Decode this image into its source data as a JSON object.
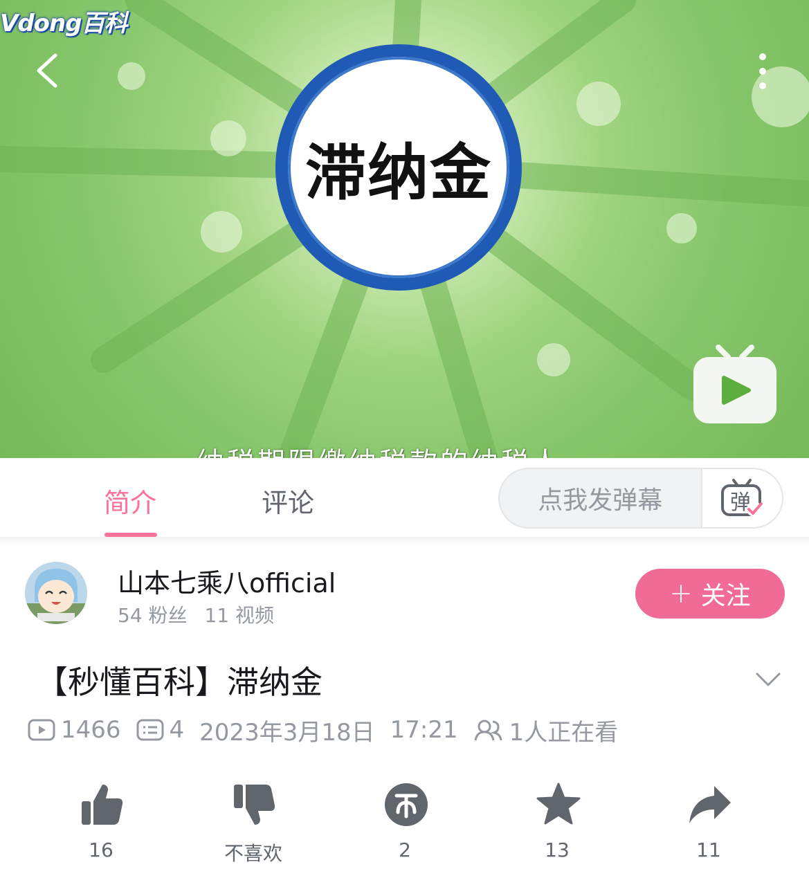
{
  "player": {
    "watermark": "Vdong百科",
    "cover_text": "滞纳金",
    "subtitle": "纳税期限缴纳税款的纳税人"
  },
  "tabs": [
    {
      "label": "简介",
      "active": true
    },
    {
      "label": "评论",
      "active": false
    }
  ],
  "danmaku": {
    "placeholder": "点我发弹幕",
    "toggle_glyph": "弹"
  },
  "uploader": {
    "name": "山本七乘八official",
    "fans": "54 粉丝",
    "videos": "11 视频",
    "follow_label": "关注",
    "follow_plus": "+"
  },
  "video": {
    "title": "【秒懂百科】滞纳金",
    "views": "1466",
    "danmaku_count": "4",
    "date": "2023年3月18日",
    "time": "17:21",
    "watching": "1人正在看"
  },
  "actions": [
    {
      "name": "like",
      "icon": "thumbs-up-icon",
      "label": "16"
    },
    {
      "name": "dislike",
      "icon": "thumbs-down-icon",
      "label": "不喜欢"
    },
    {
      "name": "coin",
      "icon": "coin-icon",
      "label": "2"
    },
    {
      "name": "favorite",
      "icon": "star-icon",
      "label": "13"
    },
    {
      "name": "share",
      "icon": "share-icon",
      "label": "11"
    }
  ],
  "colors": {
    "accent_pink": "#fb7299",
    "follow_pink": "#f06b95",
    "cover_ring_blue": "#1f5bb5",
    "icon_gray": "#61666d",
    "meta_gray": "#9499a0"
  }
}
